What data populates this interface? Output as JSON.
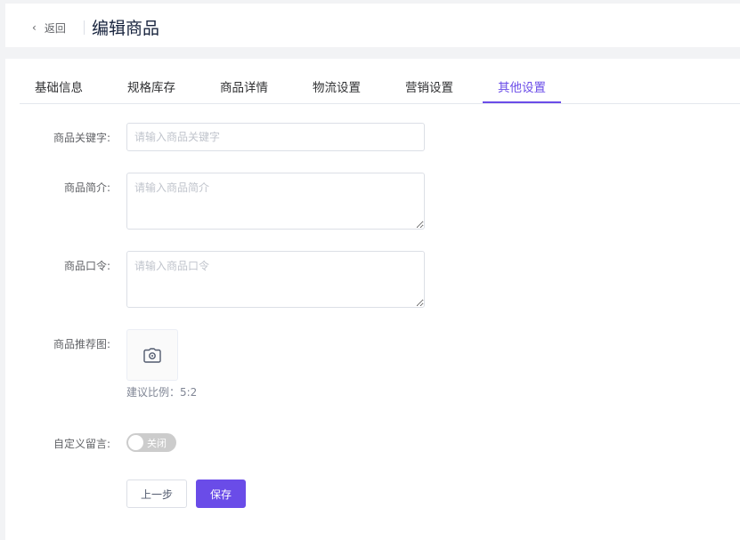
{
  "header": {
    "back_label": "返回",
    "title": "编辑商品"
  },
  "tabs": [
    {
      "label": "基础信息",
      "active": false
    },
    {
      "label": "规格库存",
      "active": false
    },
    {
      "label": "商品详情",
      "active": false
    },
    {
      "label": "物流设置",
      "active": false
    },
    {
      "label": "营销设置",
      "active": false
    },
    {
      "label": "其他设置",
      "active": true
    }
  ],
  "form": {
    "keyword": {
      "label": "商品关键字:",
      "value": "",
      "placeholder": "请输入商品关键字"
    },
    "summary": {
      "label": "商品简介:",
      "value": "",
      "placeholder": "请输入商品简介"
    },
    "command": {
      "label": "商品口令:",
      "value": "",
      "placeholder": "请输入商品口令"
    },
    "recommend_image": {
      "label": "商品推荐图:",
      "hint": "建议比例：5:2",
      "icon": "camera-icon"
    },
    "custom_message": {
      "label": "自定义留言:",
      "switch_text": "关闭",
      "on": false
    }
  },
  "actions": {
    "prev_label": "上一步",
    "save_label": "保存"
  },
  "colors": {
    "accent": "#6a4ce8",
    "switch_off": "#cccccc"
  }
}
